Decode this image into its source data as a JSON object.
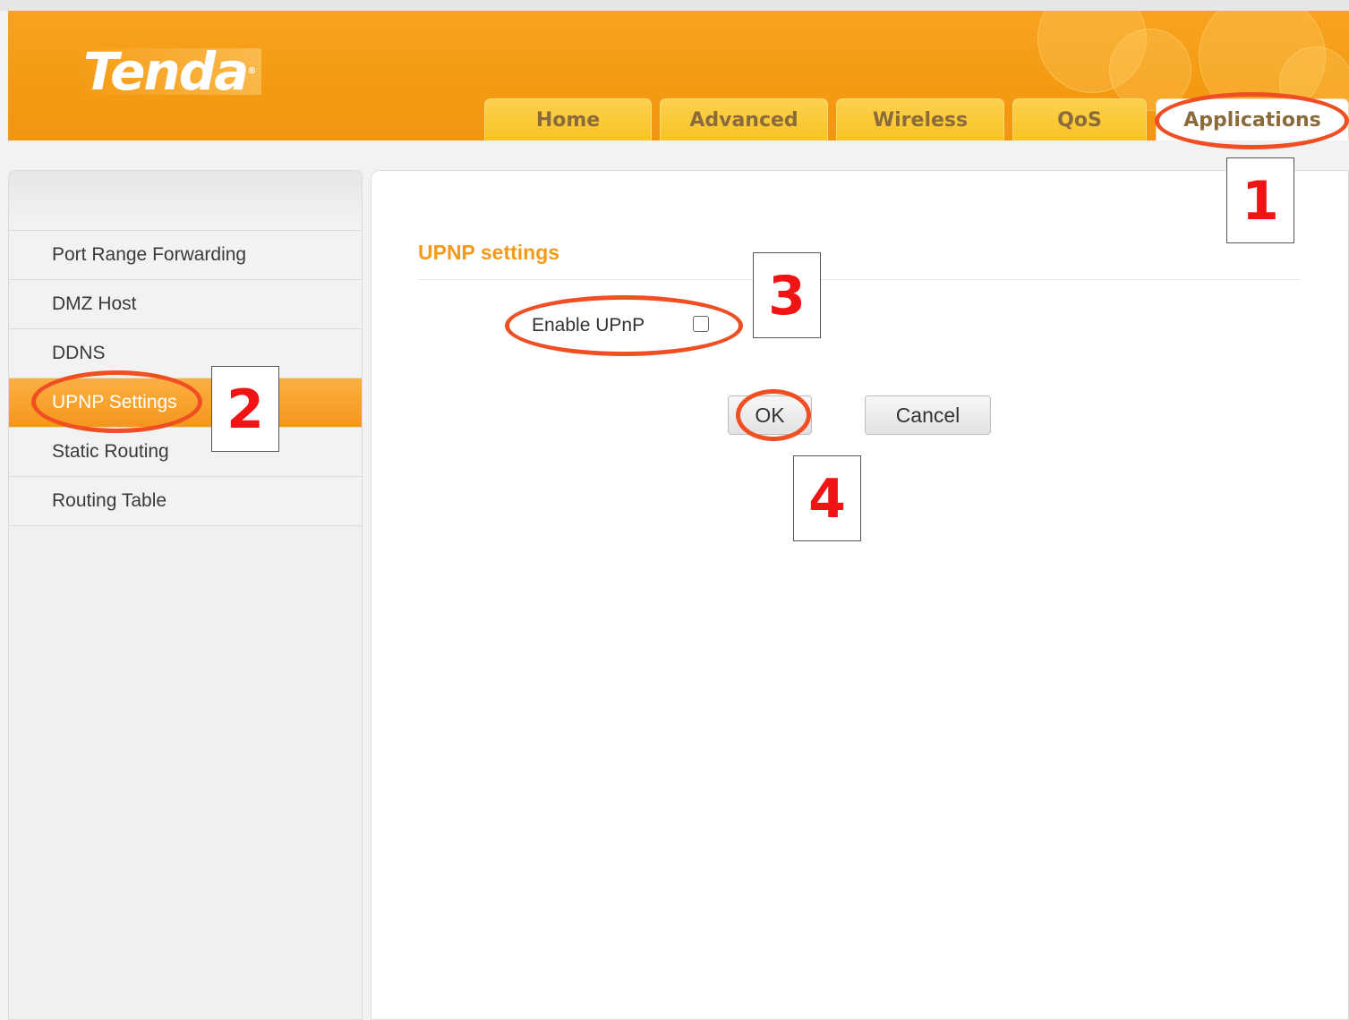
{
  "brand": {
    "logo_text": "Tenda",
    "logo_mark": "®"
  },
  "nav_tabs": [
    {
      "label": "Home"
    },
    {
      "label": "Advanced"
    },
    {
      "label": "Wireless"
    },
    {
      "label": "QoS"
    },
    {
      "label": "Applications",
      "active": true
    }
  ],
  "sidebar": {
    "items": [
      {
        "label": "Port Range Forwarding"
      },
      {
        "label": "DMZ Host"
      },
      {
        "label": "DDNS"
      },
      {
        "label": "UPNP Settings",
        "active": true
      },
      {
        "label": "Static Routing"
      },
      {
        "label": "Routing Table"
      }
    ]
  },
  "main": {
    "section_title": "UPNP settings",
    "enable_upnp": {
      "label": "Enable UPnP",
      "checked": false
    },
    "ok_label": "OK",
    "cancel_label": "Cancel"
  },
  "annotations": {
    "step1": "1",
    "step2": "2",
    "step3": "3",
    "step4": "4",
    "highlight_color": "#f04e23",
    "number_color": "#f01414"
  },
  "colors": {
    "header_orange": "#f49a12",
    "tab_yellow": "#f9c327",
    "active_item": "#f5961d",
    "title_orange": "#f39a1c"
  }
}
